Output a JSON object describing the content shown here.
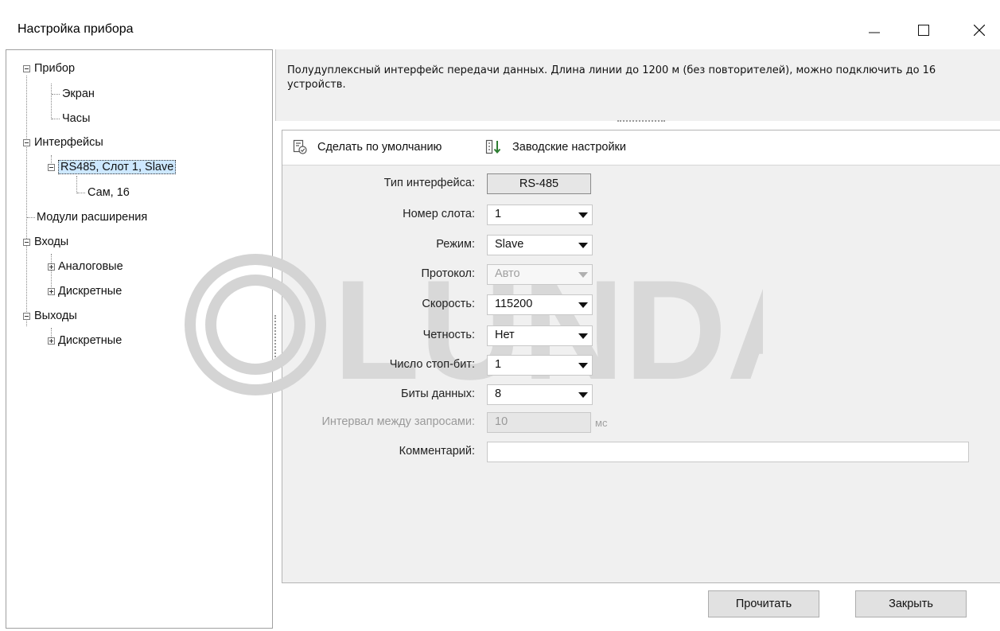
{
  "window": {
    "title": "Настройка прибора"
  },
  "tree": {
    "items": [
      {
        "label": "Прибор"
      },
      {
        "label": "Экран"
      },
      {
        "label": "Часы"
      },
      {
        "label": "Интерфейсы"
      },
      {
        "label": "RS485, Слот 1, Slave"
      },
      {
        "label": "Сам, 16"
      },
      {
        "label": "Модули расширения"
      },
      {
        "label": "Входы"
      },
      {
        "label": "Аналоговые"
      },
      {
        "label": "Дискретные"
      },
      {
        "label": "Выходы"
      },
      {
        "label": "Дискретные"
      }
    ]
  },
  "description": {
    "text": "Полудуплексный интерфейс передачи данных. Длина линии до 1200 м (без повторителей), можно подключить до 16 устройств."
  },
  "toolbar": {
    "default_label": "Сделать по умолчанию",
    "factory_label": "Заводские настройки",
    "default_icon": "set-default-icon",
    "factory_icon": "factory-settings-icon"
  },
  "form": {
    "interface_type": {
      "label": "Тип интерфейса:",
      "value": "RS-485"
    },
    "slot": {
      "label": "Номер слота:",
      "value": "1"
    },
    "mode": {
      "label": "Режим:",
      "value": "Slave"
    },
    "protocol": {
      "label": "Протокол:",
      "value": "Авто"
    },
    "speed": {
      "label": "Скорость:",
      "value": "115200"
    },
    "parity": {
      "label": "Четность:",
      "value": "Нет"
    },
    "stop_bits": {
      "label": "Число стоп-бит:",
      "value": "1"
    },
    "data_bits": {
      "label": "Биты данных:",
      "value": "8"
    },
    "interval": {
      "label": "Интервал между запросами:",
      "value": "10",
      "unit": "мс"
    },
    "comment": {
      "label": "Комментарий:",
      "value": ""
    }
  },
  "watermark": {
    "text": "LUNDA"
  },
  "footer": {
    "read_label": "Прочитать",
    "close_label": "Закрыть"
  }
}
